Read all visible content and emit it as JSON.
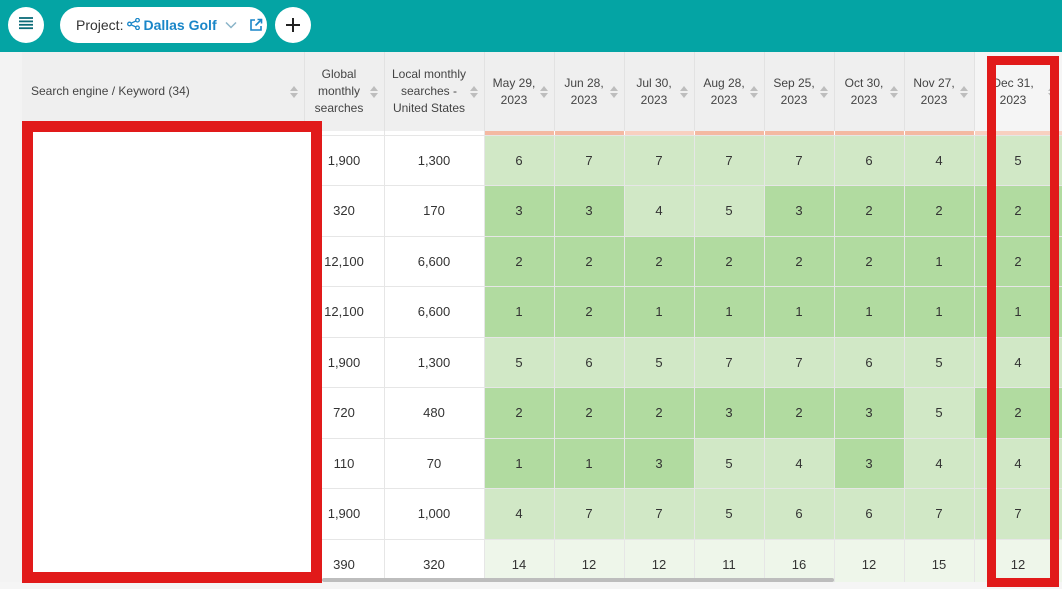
{
  "topbar": {
    "project_label": "Project:",
    "project_name": "Dallas Golf",
    "icons": [
      "menu-icon",
      "share-nodes-icon",
      "chevron-down-icon",
      "external-link-icon",
      "plus-icon"
    ],
    "accent_color": "#04a4a4",
    "link_color": "#1a86c8"
  },
  "table": {
    "headers": {
      "keyword": "Search engine / Keyword (34)",
      "global": "Global monthly searches",
      "local": "Local monthly searches - United States",
      "dates": [
        "May 29, 2023",
        "Jun 28, 2023",
        "Jul 30, 2023",
        "Aug 28, 2023",
        "Sep 25, 2023",
        "Oct 30, 2023",
        "Nov 27, 2023",
        "Dec 31, 2023"
      ]
    },
    "rows": [
      {
        "global": "1,900",
        "local": "1,300",
        "ranks": [
          "6",
          "7",
          "7",
          "7",
          "7",
          "6",
          "4",
          "5"
        ]
      },
      {
        "global": "320",
        "local": "170",
        "ranks": [
          "3",
          "3",
          "4",
          "5",
          "3",
          "2",
          "2",
          "2"
        ]
      },
      {
        "global": "12,100",
        "local": "6,600",
        "ranks": [
          "2",
          "2",
          "2",
          "2",
          "2",
          "2",
          "1",
          "2"
        ]
      },
      {
        "global": "12,100",
        "local": "6,600",
        "ranks": [
          "1",
          "2",
          "1",
          "1",
          "1",
          "1",
          "1",
          "1"
        ]
      },
      {
        "global": "1,900",
        "local": "1,300",
        "ranks": [
          "5",
          "6",
          "5",
          "7",
          "7",
          "6",
          "5",
          "4"
        ]
      },
      {
        "global": "720",
        "local": "480",
        "ranks": [
          "2",
          "2",
          "2",
          "3",
          "2",
          "3",
          "5",
          "2"
        ]
      },
      {
        "global": "110",
        "local": "70",
        "ranks": [
          "1",
          "1",
          "3",
          "5",
          "4",
          "3",
          "4",
          "4"
        ]
      },
      {
        "global": "1,900",
        "local": "1,000",
        "ranks": [
          "4",
          "7",
          "7",
          "5",
          "6",
          "6",
          "7",
          "7"
        ]
      },
      {
        "global": "390",
        "local": "320",
        "ranks": [
          "14",
          "12",
          "12",
          "11",
          "16",
          "12",
          "15",
          "12"
        ]
      }
    ]
  },
  "annotations": {
    "redaction_color": "#e11a1a",
    "highlight_column": "Dec 31, 2023"
  }
}
